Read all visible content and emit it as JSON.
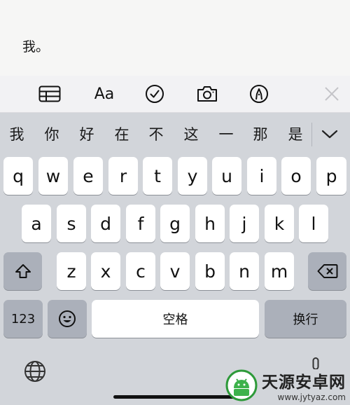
{
  "note": {
    "text": "我。"
  },
  "toolbar": {
    "items": [
      {
        "name": "table-icon"
      },
      {
        "name": "text-format-icon",
        "label": "Aa"
      },
      {
        "name": "checklist-icon"
      },
      {
        "name": "camera-icon"
      },
      {
        "name": "markup-pen-icon"
      },
      {
        "name": "close-icon"
      }
    ]
  },
  "candidates": [
    "我",
    "你",
    "好",
    "在",
    "不",
    "这",
    "一",
    "那",
    "是"
  ],
  "keyboard": {
    "row1": [
      "q",
      "w",
      "e",
      "r",
      "t",
      "y",
      "u",
      "i",
      "o",
      "p"
    ],
    "row2": [
      "a",
      "s",
      "d",
      "f",
      "g",
      "h",
      "j",
      "k",
      "l"
    ],
    "row3": [
      "z",
      "x",
      "c",
      "v",
      "b",
      "n",
      "m"
    ],
    "numbers_label": "123",
    "space_label": "空格",
    "return_label": "换行"
  },
  "watermark": {
    "title": "天源安卓网",
    "url": "www.jytyaz.com"
  }
}
